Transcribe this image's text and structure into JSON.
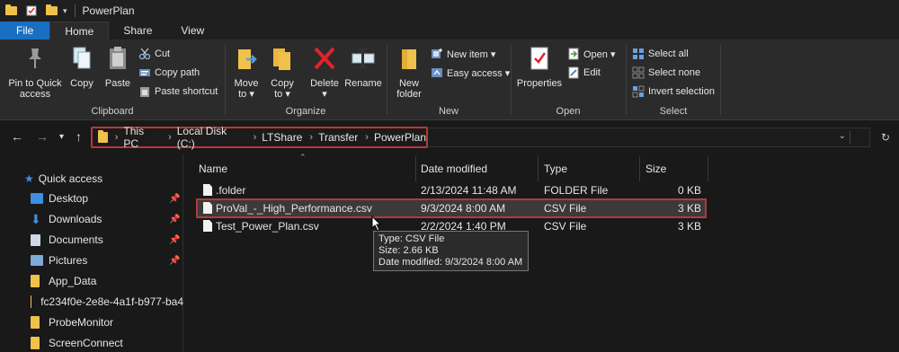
{
  "window": {
    "title": "PowerPlan"
  },
  "tabs": {
    "file": "File",
    "home": "Home",
    "share": "Share",
    "view": "View"
  },
  "ribbon": {
    "clipboard": {
      "label": "Clipboard",
      "pin_line1": "Pin to Quick",
      "pin_line2": "access",
      "copy": "Copy",
      "paste": "Paste",
      "cut": "Cut",
      "copy_path": "Copy path",
      "paste_shortcut": "Paste shortcut"
    },
    "organize": {
      "label": "Organize",
      "move_line1": "Move",
      "move_line2": "to ▾",
      "copy_line1": "Copy",
      "copy_line2": "to ▾",
      "delete": "Delete ▾",
      "rename": "Rename"
    },
    "new": {
      "label": "New",
      "folder_line1": "New",
      "folder_line2": "folder",
      "new_item": "New item ▾",
      "easy_access": "Easy access ▾"
    },
    "open": {
      "label": "Open",
      "properties": "Properties",
      "open": "Open ▾",
      "edit": "Edit"
    },
    "select": {
      "label": "Select",
      "select_all": "Select all",
      "select_none": "Select none",
      "invert": "Invert selection"
    }
  },
  "address": {
    "crumbs": [
      "This PC",
      "Local Disk (C:)",
      "LTShare",
      "Transfer",
      "PowerPlan"
    ]
  },
  "sidebar": {
    "quick_access": "Quick access",
    "items": [
      {
        "label": "Desktop",
        "pinned": true
      },
      {
        "label": "Downloads",
        "pinned": true
      },
      {
        "label": "Documents",
        "pinned": true
      },
      {
        "label": "Pictures",
        "pinned": true
      },
      {
        "label": "App_Data",
        "pinned": false
      },
      {
        "label": "fc234f0e-2e8e-4a1f-b977-ba4",
        "pinned": false
      },
      {
        "label": "ProbeMonitor",
        "pinned": false
      },
      {
        "label": "ScreenConnect",
        "pinned": false
      }
    ]
  },
  "columns": {
    "name": "Name",
    "date": "Date modified",
    "type": "Type",
    "size": "Size"
  },
  "files": [
    {
      "name": ".folder",
      "date": "2/13/2024 11:48 AM",
      "type": "FOLDER File",
      "size": "0 KB"
    },
    {
      "name": "ProVal_-_High_Performance.csv",
      "date": "9/3/2024 8:00 AM",
      "type": "CSV File",
      "size": "3 KB"
    },
    {
      "name": "Test_Power_Plan.csv",
      "date": "2/2/2024 1:40 PM",
      "type": "CSV File",
      "size": "3 KB"
    }
  ],
  "tooltip": {
    "type": "Type: CSV File",
    "size": "Size: 2.66 KB",
    "date": "Date modified: 9/3/2024 8:00 AM"
  },
  "colors": {
    "accent": "#1a6fc2",
    "highlight_border": "#b33a3a",
    "folder": "#f0c14b"
  }
}
